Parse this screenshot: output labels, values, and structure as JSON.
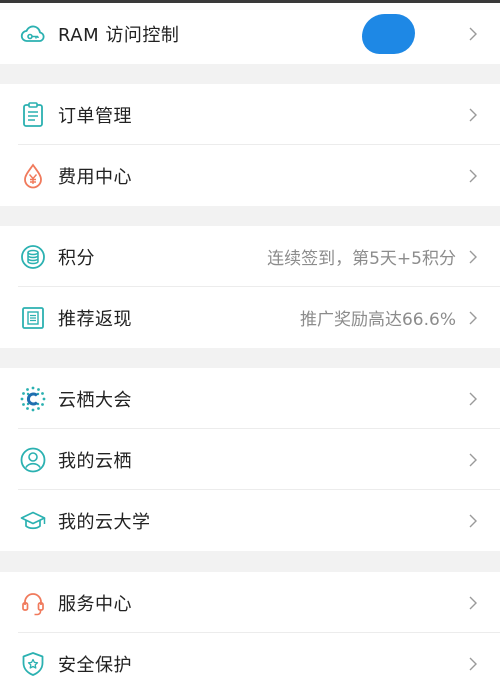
{
  "colors": {
    "teal": "#2bb1b1",
    "accent_blue": "#1e88e5",
    "orange": "#f07a5c",
    "text": "#222222",
    "subtext": "#8c8c8c"
  },
  "groups": [
    {
      "items": [
        {
          "label": "RAM 访问控制",
          "icon": "cloud-key-icon",
          "sub": ""
        }
      ]
    },
    {
      "items": [
        {
          "label": "订单管理",
          "icon": "clipboard-icon",
          "sub": ""
        },
        {
          "label": "费用中心",
          "icon": "yen-drop-icon",
          "sub": ""
        }
      ]
    },
    {
      "items": [
        {
          "label": "积分",
          "icon": "coin-stack-icon",
          "sub": "连续签到，第5天+5积分"
        },
        {
          "label": "推荐返现",
          "icon": "document-icon",
          "sub": "推广奖励高达66.6%"
        }
      ]
    },
    {
      "items": [
        {
          "label": "云栖大会",
          "icon": "yunqi-logo-icon",
          "sub": ""
        },
        {
          "label": "我的云栖",
          "icon": "user-circle-icon",
          "sub": ""
        },
        {
          "label": "我的云大学",
          "icon": "graduation-cap-icon",
          "sub": ""
        }
      ]
    },
    {
      "items": [
        {
          "label": "服务中心",
          "icon": "headset-icon",
          "sub": ""
        },
        {
          "label": "安全保护",
          "icon": "shield-star-icon",
          "sub": ""
        }
      ]
    }
  ]
}
